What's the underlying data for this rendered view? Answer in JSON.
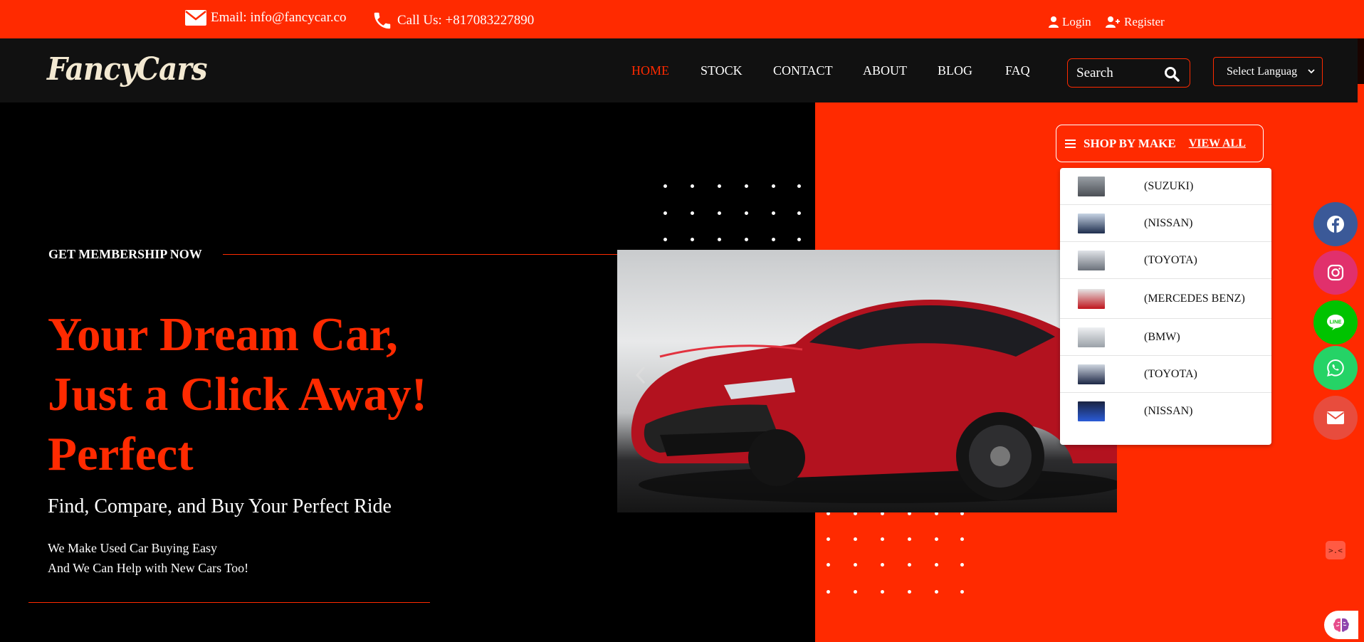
{
  "topbar": {
    "email": "Email: info@fancycar.co",
    "phone": "Call Us: +817083227890",
    "login": "Login",
    "register": "Register",
    "icons": [
      "envelope-icon",
      "phone-icon",
      "user-icon",
      "user-plus-icon"
    ]
  },
  "navbar": {
    "logo": "FancyCars",
    "links": [
      "HOME",
      "STOCK",
      "CONTACT",
      "ABOUT",
      "BLOG",
      "FAQ"
    ],
    "active": "HOME",
    "search_placeholder": "Search",
    "language": "Select Languag"
  },
  "hero": {
    "kicker": "GET MEMBERSHIP NOW",
    "headline": [
      "Your Dream Car,",
      "Just a Click Away!",
      "Perfect"
    ],
    "subhead": "Find, Compare, and Buy Your Perfect Ride",
    "desc": [
      "We Make Used Car Buying Easy",
      "And We Can Help with New Cars Too!"
    ]
  },
  "shop_by_make": {
    "title": "SHOP BY MAKE",
    "view_all": "VIEW ALL",
    "makes": [
      "(SUZUKI)",
      "(NISSAN)",
      "(TOYOTA)",
      "(MERCEDES BENZ)",
      "(BMW)",
      "(TOYOTA)",
      "(NISSAN)"
    ]
  },
  "social": [
    "facebook-icon",
    "instagram-icon",
    "line-icon",
    "whatsapp-icon",
    "mail-icon"
  ],
  "colors": {
    "accent": "#ff2a00",
    "navbar_bg": "#111111",
    "hero_bg": "#000000",
    "facebook": "#3b5998",
    "instagram": "#e1306c",
    "line": "#00c300",
    "whatsapp": "#25d366",
    "mail": "#e84c3d"
  }
}
